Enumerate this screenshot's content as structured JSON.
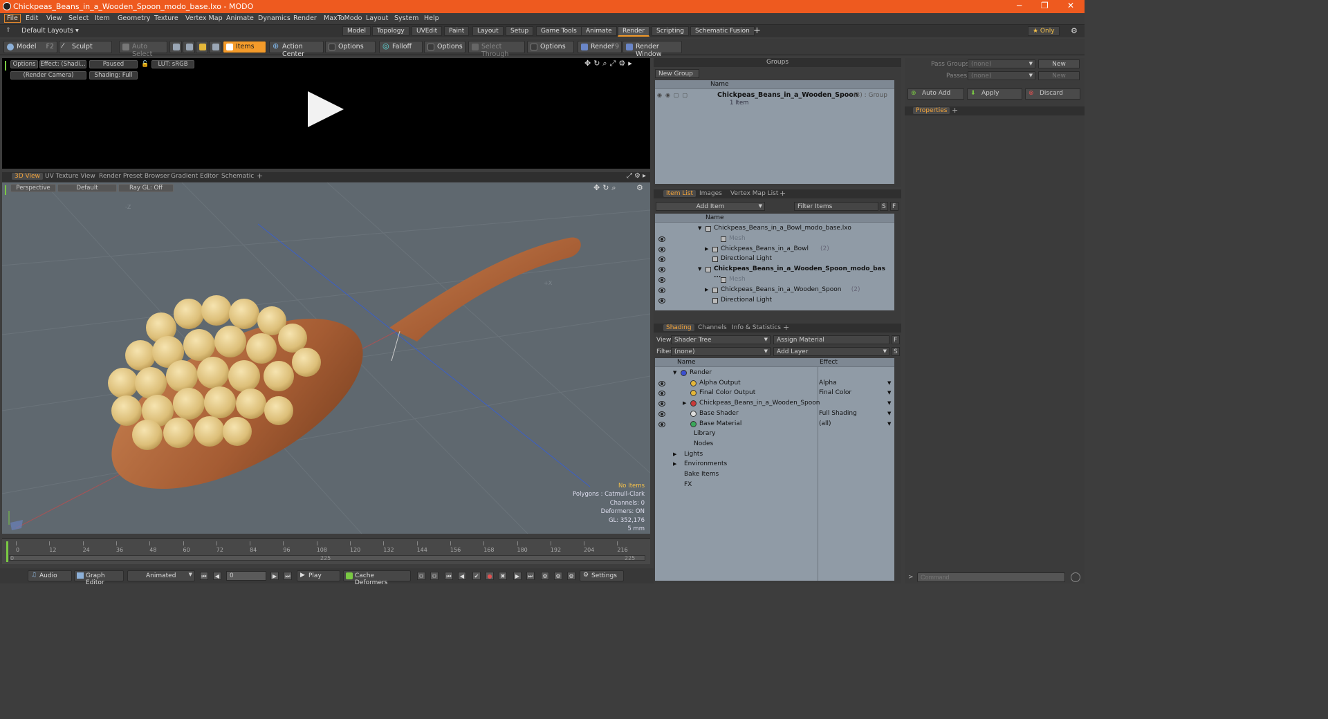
{
  "window": {
    "title": "Chickpeas_Beans_in_a_Wooden_Spoon_modo_base.lxo - MODO",
    "min": "─",
    "max": "❐",
    "close": "✕"
  },
  "menu": [
    "File",
    "Edit",
    "View",
    "Select",
    "Item",
    "Geometry",
    "Texture",
    "Vertex Map",
    "Animate",
    "Dynamics",
    "Render",
    "MaxToModo",
    "Layout",
    "System",
    "Help"
  ],
  "layouts": {
    "current": "Default Layouts ▾",
    "tabs": [
      "Model",
      "Topology",
      "UVEdit",
      "Paint",
      "Layout",
      "Setup",
      "Game Tools",
      "Animate",
      "Render",
      "Scripting",
      "Schematic Fusion"
    ],
    "active": "Render",
    "only": "★ Only"
  },
  "toolbar": {
    "model": "Model",
    "model_key": "F2",
    "sculpt": "Sculpt",
    "auto_select": "Auto Select",
    "items": "Items",
    "action_center": "Action Center",
    "options1": "Options",
    "falloff": "Falloff",
    "options2": "Options",
    "select_through": "Select Through",
    "options3": "Options",
    "render": "Render",
    "render_key": "F9",
    "render_window": "Render Window"
  },
  "preview": {
    "options": "Options",
    "effect": "Effect: (Shadi...",
    "paused": "Paused",
    "lut": "LUT: sRGB",
    "camera": "(Render Camera)",
    "shading": "Shading: Full"
  },
  "viewtabs": [
    "3D View",
    "UV Texture View",
    "Render Preset Browser",
    "Gradient Editor",
    "Schematic"
  ],
  "view3d": {
    "perspective": "Perspective",
    "default": "Default",
    "raygl": "Ray GL: Off",
    "axis_z": "-Z",
    "axis_x": "+X",
    "info": {
      "no_items": "No Items",
      "polygons": "Polygons : Catmull-Clark",
      "channels": "Channels: 0",
      "deformers": "Deformers: ON",
      "gl": "GL: 352,176",
      "scale": "5 mm"
    }
  },
  "timeline": {
    "ticks": [
      "0",
      "12",
      "24",
      "36",
      "48",
      "60",
      "72",
      "84",
      "96",
      "108",
      "120",
      "132",
      "144",
      "156",
      "168",
      "180",
      "192",
      "204",
      "216"
    ],
    "start": "0",
    "mid": "225",
    "end": "225"
  },
  "bottom": {
    "audio": "Audio",
    "graph_editor": "Graph Editor",
    "animated": "Animated",
    "frame": "0",
    "play": "Play",
    "cache_deformers": "Cache Deformers",
    "settings": "Settings"
  },
  "groups": {
    "title": "Groups",
    "new_group": "New Group",
    "col_name": "Name",
    "row_name": "Chickpeas_Beans_in_a_Wooden_Spoon",
    "row_suffix": "(3) : Group",
    "row_sub": "1 Item"
  },
  "passes": {
    "pass_groups_label": "Pass Groups",
    "pass_groups_value": "(none)",
    "passes_label": "Passes",
    "passes_value": "(none)",
    "new1": "New",
    "new2": "New",
    "auto_add": "Auto Add",
    "apply": "Apply",
    "discard": "Discard",
    "properties": "Properties"
  },
  "itemlist": {
    "tabs": [
      "Item List",
      "Images",
      "Vertex Map List"
    ],
    "add_item": "Add Item",
    "filter": "Filter Items",
    "s": "S",
    "f": "F",
    "col_name": "Name",
    "rows": [
      {
        "label": "Chickpeas_Beans_in_a_Bowl_modo_base.lxo",
        "indent": 0,
        "bold": false,
        "eye": false,
        "arrow": "▼"
      },
      {
        "label": "Mesh",
        "indent": 2,
        "bold": false,
        "eye": true,
        "arrow": "",
        "gray": true
      },
      {
        "label": "Chickpeas_Beans_in_a_Bowl",
        "suffix": "(2)",
        "indent": 1,
        "bold": false,
        "eye": true,
        "arrow": "▶"
      },
      {
        "label": "Directional Light",
        "indent": 1,
        "bold": false,
        "eye": true,
        "arrow": ""
      },
      {
        "label": "Chickpeas_Beans_in_a_Wooden_Spoon_modo_bas ...",
        "indent": 0,
        "bold": true,
        "eye": true,
        "arrow": "▼"
      },
      {
        "label": "Mesh",
        "indent": 2,
        "bold": false,
        "eye": true,
        "arrow": "",
        "gray": true
      },
      {
        "label": "Chickpeas_Beans_in_a_Wooden_Spoon",
        "suffix": "(2)",
        "indent": 1,
        "bold": false,
        "eye": true,
        "arrow": "▶"
      },
      {
        "label": "Directional Light",
        "indent": 1,
        "bold": false,
        "eye": true,
        "arrow": ""
      }
    ]
  },
  "shading": {
    "tabs": [
      "Shading",
      "Channels",
      "Info & Statistics"
    ],
    "view_label": "View",
    "view_value": "Shader Tree",
    "assign": "Assign Material",
    "filter_label": "Filter",
    "filter_value": "(none)",
    "add_layer": "Add Layer",
    "col_name": "Name",
    "col_effect": "Effect",
    "rows": [
      {
        "label": "Render",
        "effect": "",
        "indent": 0,
        "eye": false,
        "arrow": "▼",
        "icon": "#3b4fd0"
      },
      {
        "label": "Alpha Output",
        "effect": "Alpha",
        "indent": 1,
        "eye": true,
        "arrow": "",
        "icon": "#e3b63a"
      },
      {
        "label": "Final Color Output",
        "effect": "Final Color",
        "indent": 1,
        "eye": true,
        "arrow": "",
        "icon": "#e3b63a"
      },
      {
        "label": "Chickpeas_Beans_in_a_Wooden_Spoon",
        "effect": "",
        "indent": 1,
        "eye": true,
        "arrow": "▶",
        "icon": "#c83a3a"
      },
      {
        "label": "Base Shader",
        "effect": "Full Shading",
        "indent": 1,
        "eye": true,
        "arrow": "",
        "icon": "#dddddd"
      },
      {
        "label": "Base Material",
        "effect": "(all)",
        "indent": 1,
        "eye": true,
        "arrow": "",
        "icon": "#3aa85a"
      },
      {
        "label": "Library",
        "effect": "",
        "indent": 1,
        "eye": false,
        "arrow": "",
        "icon": ""
      },
      {
        "label": "Nodes",
        "effect": "",
        "indent": 1,
        "eye": false,
        "arrow": "",
        "icon": ""
      },
      {
        "label": "Lights",
        "effect": "",
        "indent": 0,
        "eye": false,
        "arrow": "▶",
        "icon": ""
      },
      {
        "label": "Environments",
        "effect": "",
        "indent": 0,
        "eye": false,
        "arrow": "▶",
        "icon": ""
      },
      {
        "label": "Bake Items",
        "effect": "",
        "indent": 0,
        "eye": false,
        "arrow": "",
        "icon": ""
      },
      {
        "label": "FX",
        "effect": "",
        "indent": 0,
        "eye": false,
        "arrow": "",
        "icon": ""
      }
    ]
  },
  "command": {
    "placeholder": "Command"
  }
}
